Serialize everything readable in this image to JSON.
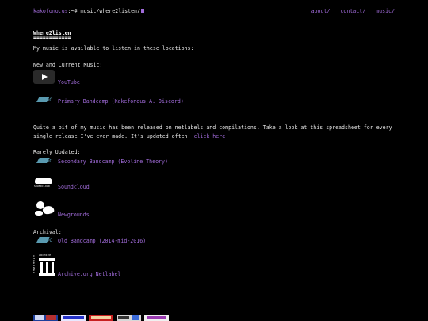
{
  "header": {
    "prompt_user": "kakofono.us",
    "prompt_path": ":~# music/where2listen/",
    "nav": [
      "about/",
      "contact/",
      "music/"
    ]
  },
  "page": {
    "title": "Where2listen",
    "underline": "============",
    "intro": "My music is available to listen in these locations:"
  },
  "sections": {
    "new_current": "New and Current Music:",
    "youtube": "YouTube",
    "primary_bandcamp": "Primary Bandcamp (Kakefonous A. Discord)",
    "note_text": "Quite a bit of my music has been released on netlabels and compilations. Take a look at this spreadsheet for every single release I've ever made. It's updated often!",
    "note_link": "click here",
    "rarely_updated": "Rarely Updated:",
    "secondary_bandcamp": "Secondary Bandcamp (Evoline Theory)",
    "soundcloud": "Soundcloud",
    "newgrounds": "Newgrounds",
    "archival": "Archival:",
    "old_bandcamp": "Old Bandcamp (2014-mid-2016)",
    "archive_org": "Archive.org Netlabel"
  },
  "icons": {
    "bandcamp_text": "bc",
    "soundcloud_caption": "SOUNDCLOUD",
    "archive_side": "INTERNET",
    "archive_top": "ARCHIVE"
  },
  "colors": {
    "background": "#000000",
    "text": "#e6e6e6",
    "link": "#a06bd9",
    "bandcamp": "#5a9ab0"
  }
}
